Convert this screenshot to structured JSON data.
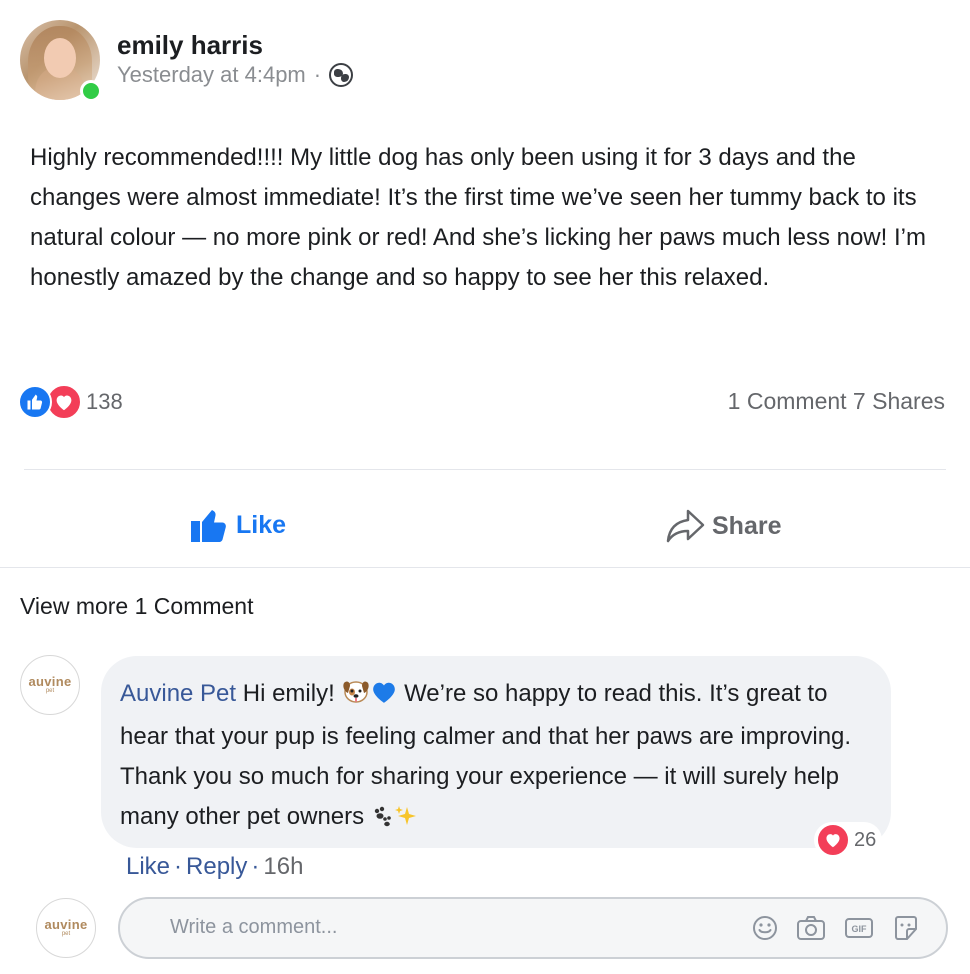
{
  "post": {
    "author": "emily harris",
    "timestamp": "Yesterday at 4:4pm",
    "separator": "·",
    "privacy_icon": "globe-icon",
    "body": "Highly recommended!!!! My little dog has only been using it for 3 days and the changes were almost immediate! It’s the first time we’ve seen her tummy back to its natural colour — no more pink or red! And she’s licking her paws much less now! I’m honestly amazed by the change and so happy to see her this relaxed.",
    "reaction_count": "138",
    "comment_share_counts": "1 Comment 7 Shares",
    "online": true
  },
  "actions": {
    "like_label": "Like",
    "share_label": "Share"
  },
  "comments": {
    "view_more": "View more 1 Comment",
    "items": [
      {
        "avatar_brand": "auvine",
        "avatar_sub": "pet",
        "author": "Auvine Pet",
        "text_part1": "Hi emily! ",
        "text_part2": " We’re so happy to read this. It’s great to hear that your pup is feeling calmer and that her paws are improving. Thank you so much for sharing your experience — it will surely help many other pet owners ",
        "reaction_count": "26",
        "like_label": "Like",
        "reply_label": "Reply",
        "separator": "·",
        "time": "16h"
      }
    ]
  },
  "composer": {
    "avatar_brand": "auvine",
    "avatar_sub": "pet",
    "placeholder": "Write a comment...",
    "icons": [
      "emoji-icon",
      "camera-icon",
      "gif-icon",
      "sticker-icon"
    ]
  },
  "colors": {
    "like_blue": "#1877f2",
    "love_red": "#f33e58",
    "link_blue": "#385898",
    "online_green": "#31cc46"
  }
}
